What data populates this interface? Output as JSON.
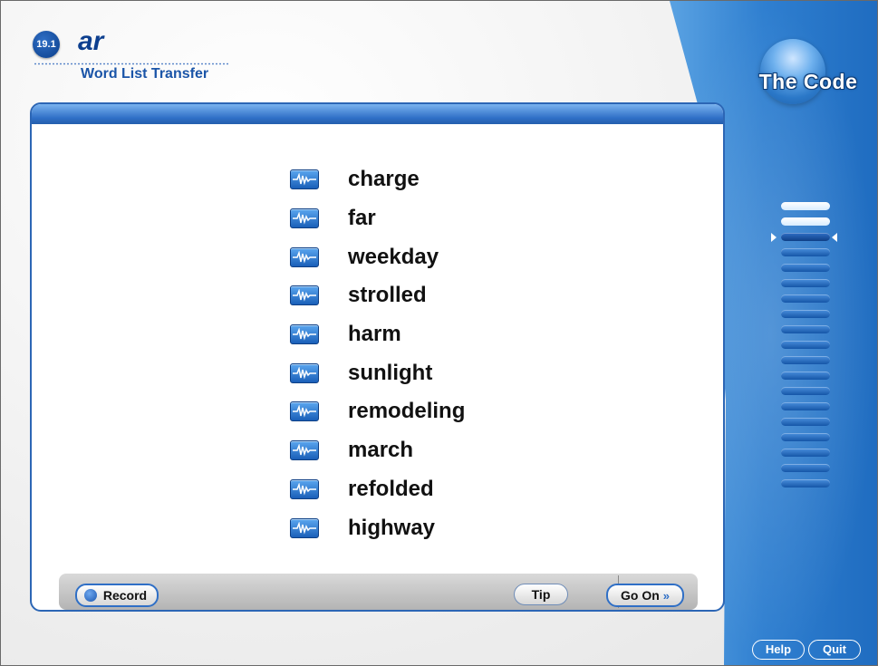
{
  "header": {
    "lesson_number": "19.1",
    "lesson_title": "ar",
    "subtitle": "Word List Transfer"
  },
  "brand": "The Code",
  "words": [
    "charge",
    "far",
    "weekday",
    "strolled",
    "harm",
    "sunlight",
    "remodeling",
    "march",
    "refolded",
    "highway"
  ],
  "toolbar": {
    "record_label": "Record",
    "tip_label": "Tip",
    "goon_label": "Go On",
    "goon_icon": "double-chevron-right-icon"
  },
  "footer": {
    "help_label": "Help",
    "quit_label": "Quit"
  },
  "progress": {
    "total_steps": 19,
    "completed_steps": 2,
    "current_step": 3
  },
  "colors": {
    "accent_blue": "#2f6fc6",
    "dark_blue": "#0d3f8f",
    "panel_blue": "#2f7fd0"
  }
}
